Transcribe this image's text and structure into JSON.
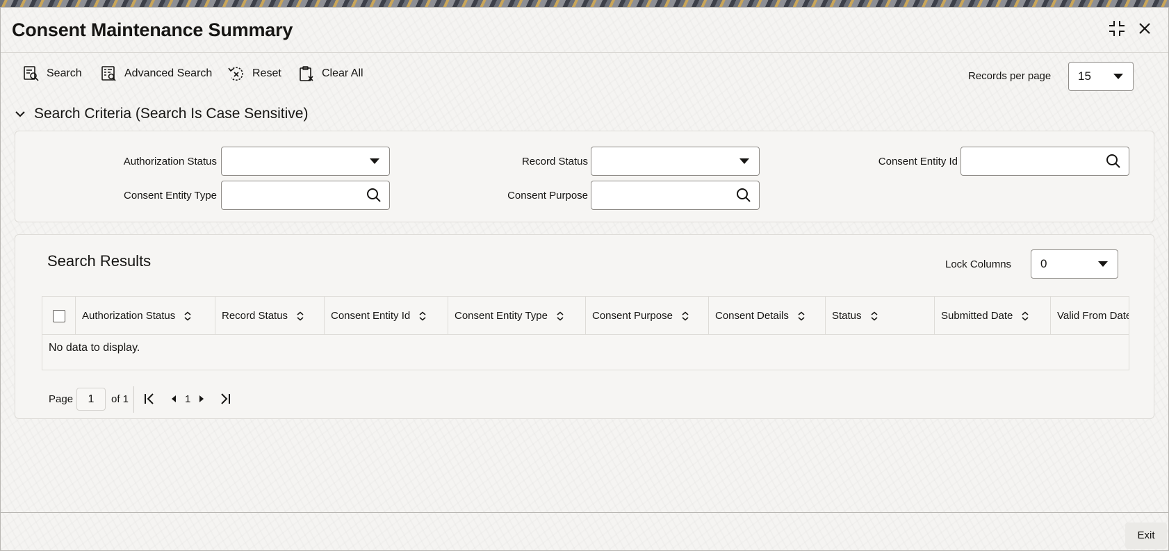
{
  "header": {
    "title": "Consent Maintenance Summary",
    "icons": [
      "collapse-icon",
      "close-icon"
    ]
  },
  "toolbar": {
    "search_label": "Search",
    "advanced_search_label": "Advanced Search",
    "reset_label": "Reset",
    "clear_all_label": "Clear All",
    "records_per_page_label": "Records per page",
    "records_per_page_value": "15"
  },
  "criteria": {
    "section_title": "Search Criteria (Search Is Case Sensitive)",
    "fields": {
      "authorization_status": "Authorization Status",
      "record_status": "Record Status",
      "consent_entity_id": "Consent Entity Id",
      "consent_entity_type": "Consent Entity Type",
      "consent_purpose": "Consent Purpose"
    }
  },
  "results": {
    "title": "Search Results",
    "lock_columns_label": "Lock Columns",
    "lock_columns_value": "0",
    "columns": [
      "Authorization Status",
      "Record Status",
      "Consent Entity Id",
      "Consent Entity Type",
      "Consent Purpose",
      "Consent Details",
      "Status",
      "Submitted Date",
      "Valid From Date"
    ],
    "empty_message": "No data to display."
  },
  "pagination": {
    "page_label": "Page",
    "current_page": "1",
    "of_label": "of 1",
    "page_number": "1"
  },
  "footer": {
    "exit_label": "Exit"
  },
  "colors": {
    "text": "#161513",
    "panel": "#f6f5f3",
    "border": "#dedcd8",
    "input_border": "#8f8c88"
  }
}
